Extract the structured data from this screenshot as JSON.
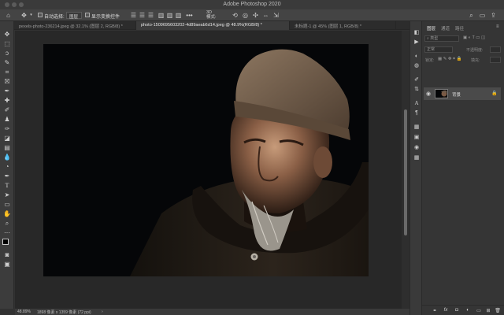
{
  "window": {
    "title": "Adobe Photoshop 2020"
  },
  "options_bar": {
    "auto_select_label": "自动选择:",
    "auto_select_target": "图层",
    "show_transform_label": "显示变换控件"
  },
  "tabs": [
    {
      "label": "pexels-photo-236214.jpeg @ 32.1% (图层 2, RGB/8) *"
    },
    {
      "label": "photo-1509695603202-4d89aeab6d14.jpeg @ 48.9%(RGB/8) *"
    },
    {
      "label": "未标题-1 @ 45% (图层 1, RGB/8) *"
    }
  ],
  "status_bar": {
    "zoom": "48.89%",
    "doc_info": "1898 像素 x 1359 像素 (72 ppi)"
  },
  "panel": {
    "tabs": [
      "图层",
      "通道",
      "路径"
    ],
    "kind_filter": "类型",
    "blend_mode": "正常",
    "opacity_label": "不透明度:",
    "lock_label": "锁定:",
    "fill_label": "填充:",
    "layers": [
      {
        "name": "背景"
      }
    ]
  },
  "icons": {
    "home": "home-icon",
    "move": "move-icon",
    "gear": "gear-icon",
    "search": "search-icon",
    "eye": "eye-icon",
    "lock": "lock-icon"
  }
}
